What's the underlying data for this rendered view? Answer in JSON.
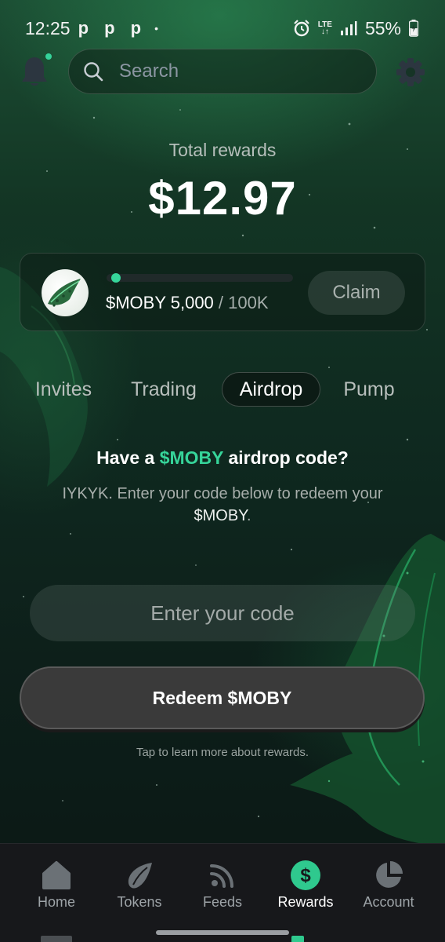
{
  "status_bar": {
    "time": "12:25",
    "notification_icons": "p p p",
    "dot": "•",
    "network": "LTE",
    "battery": "55%"
  },
  "header": {
    "search_placeholder": "Search"
  },
  "rewards": {
    "total_label": "Total rewards",
    "total_value": "$12.97"
  },
  "claim_card": {
    "amount": "$MOBY 5,000",
    "goal": "/ 100K",
    "progress_fraction": 0.05,
    "claim_label": "Claim"
  },
  "tabs": [
    {
      "label": "Invites",
      "active": false
    },
    {
      "label": "Trading",
      "active": false
    },
    {
      "label": "Airdrop",
      "active": true
    },
    {
      "label": "Pump",
      "active": false
    }
  ],
  "airdrop": {
    "heading_prefix": "Have a ",
    "heading_token": "$MOBY",
    "heading_suffix": " airdrop code?",
    "subtitle": "IYKYK. Enter your code below to redeem your",
    "subtitle_token": "$MOBY",
    "subtitle_end": ".",
    "input_placeholder": "Enter your code",
    "input_value": "",
    "redeem_label": "Redeem $MOBY",
    "learn_more": "Tap to learn more about rewards."
  },
  "bottom_nav": [
    {
      "label": "Home",
      "icon": "home-icon",
      "active": false
    },
    {
      "label": "Tokens",
      "icon": "tokens-icon",
      "active": false
    },
    {
      "label": "Feeds",
      "icon": "rss-icon",
      "active": false
    },
    {
      "label": "Rewards",
      "icon": "dollar-icon",
      "active": true
    },
    {
      "label": "Account",
      "icon": "pie-chart-icon",
      "active": false
    }
  ],
  "colors": {
    "accent": "#36d59a",
    "background": "#0f2a20",
    "nav_background": "#17181b",
    "redeem_button": "#3a3a3a"
  }
}
